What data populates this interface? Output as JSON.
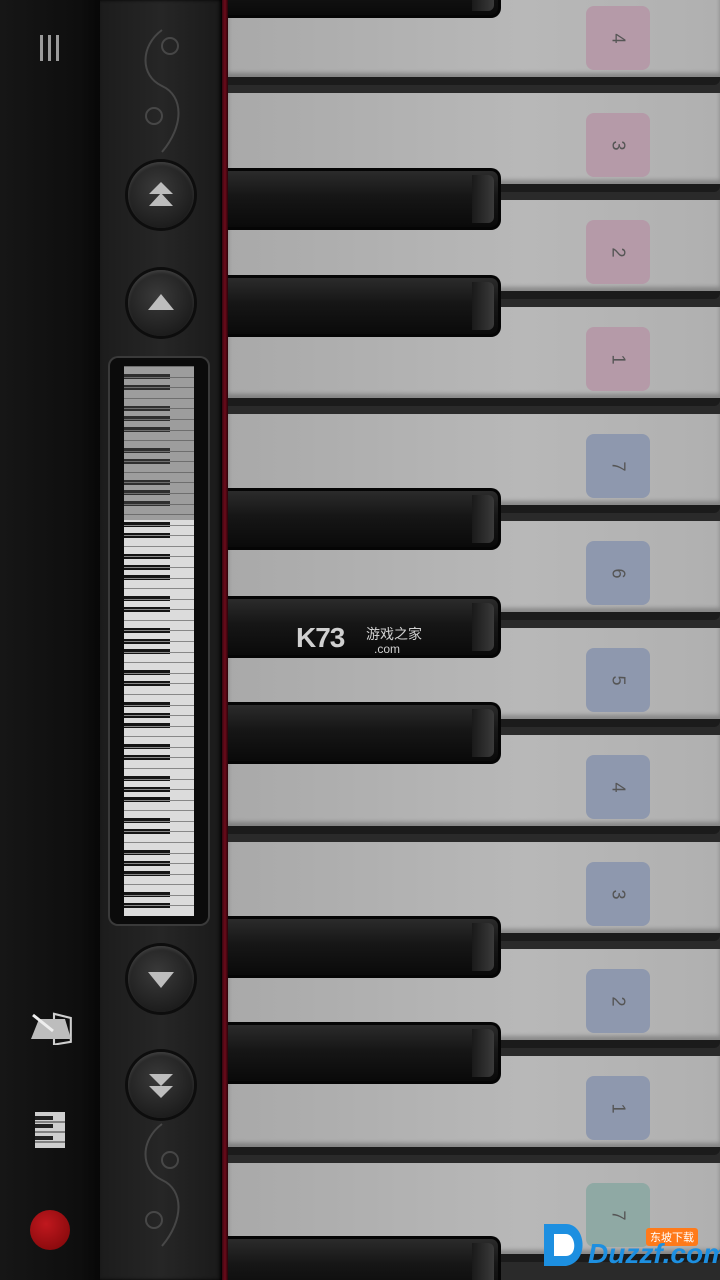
{
  "menu": {
    "icon": "hamburger-menu-icon"
  },
  "navigation": {
    "octave_up_icon": "double-chevron-up-icon",
    "key_up_icon": "chevron-up-icon",
    "key_down_icon": "chevron-down-icon",
    "octave_down_icon": "double-chevron-down-icon",
    "minimap_position": 0.28
  },
  "sidebar": {
    "metronome_icon": "metronome-icon",
    "keyboard_icon": "keyboard-icon",
    "record_icon": "record-icon",
    "record_color": "#c0181e"
  },
  "keys": {
    "labels": [
      "4",
      "3",
      "2",
      "1",
      "7",
      "6",
      "5",
      "4",
      "3",
      "2",
      "1",
      "7"
    ],
    "label_colors": {
      "pink": "#b59aa8",
      "blue": "#8e98ae",
      "teal": "#8fa9a4"
    }
  },
  "watermark": {
    "brand": "K73",
    "chinese": "游戏之家",
    "domain": ".com"
  },
  "badge": {
    "chinese": "东坡下载",
    "brand": "Duzzf.com"
  }
}
